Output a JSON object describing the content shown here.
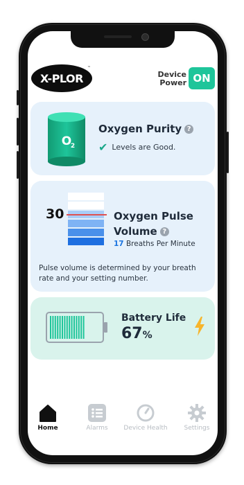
{
  "header": {
    "logo_text": "X-PLOR",
    "logo_tm": "™",
    "power_label": "Device\nPower",
    "power_state": "ON"
  },
  "purity": {
    "icon_label": "O₂",
    "title": "Oxygen Purity",
    "status": "Levels are Good."
  },
  "pulse": {
    "setting": "30",
    "title_line1": "Oxygen Pulse",
    "title_line2": "Volume",
    "breaths": "17",
    "breaths_label": " Breaths Per Minute",
    "description": "Pulse volume is determined by your breath rate and your setting number.",
    "bar_colors": [
      "#ffffff",
      "#ffffff",
      "#a9cdf8",
      "#7fb3f4",
      "#4a90ea",
      "#1e6fe0"
    ]
  },
  "battery": {
    "title": "Battery Life",
    "percent": "67",
    "percent_unit": "%",
    "level": 0.67,
    "color": "#1ec59a"
  },
  "tabs": [
    {
      "label": "Home",
      "icon": "home-icon",
      "active": true
    },
    {
      "label": "Alarms",
      "icon": "list-icon",
      "active": false
    },
    {
      "label": "Device Health",
      "icon": "gauge-icon",
      "active": false
    },
    {
      "label": "Settings",
      "icon": "gear-icon",
      "active": false
    }
  ],
  "colors": {
    "accent": "#1ec59a",
    "card_blue": "#e6f1fb",
    "card_green": "#d9f3ec",
    "bolt": "#f7b52b"
  }
}
